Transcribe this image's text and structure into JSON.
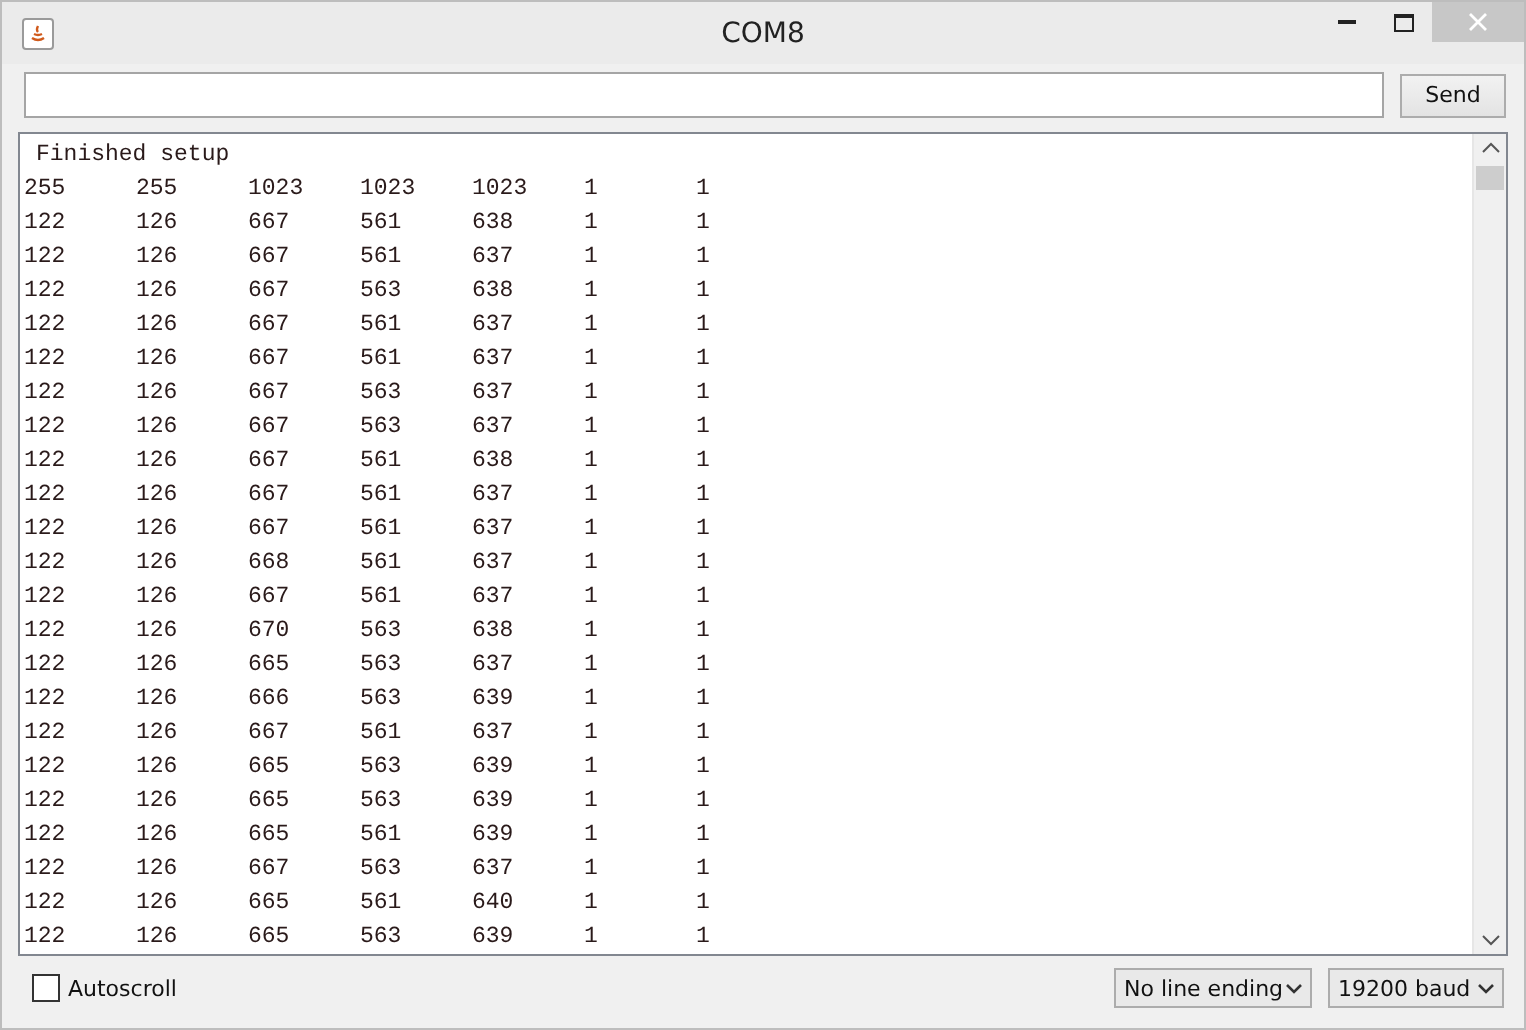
{
  "window": {
    "title": "COM8"
  },
  "send_button": "Send",
  "output": {
    "header": "Finished setup",
    "rows": [
      [
        "255",
        "255",
        "1023",
        "1023",
        "1023",
        "1",
        "1"
      ],
      [
        "122",
        "126",
        "667",
        "561",
        "638",
        "1",
        "1"
      ],
      [
        "122",
        "126",
        "667",
        "561",
        "637",
        "1",
        "1"
      ],
      [
        "122",
        "126",
        "667",
        "563",
        "638",
        "1",
        "1"
      ],
      [
        "122",
        "126",
        "667",
        "561",
        "637",
        "1",
        "1"
      ],
      [
        "122",
        "126",
        "667",
        "561",
        "637",
        "1",
        "1"
      ],
      [
        "122",
        "126",
        "667",
        "563",
        "637",
        "1",
        "1"
      ],
      [
        "122",
        "126",
        "667",
        "563",
        "637",
        "1",
        "1"
      ],
      [
        "122",
        "126",
        "667",
        "561",
        "638",
        "1",
        "1"
      ],
      [
        "122",
        "126",
        "667",
        "561",
        "637",
        "1",
        "1"
      ],
      [
        "122",
        "126",
        "667",
        "561",
        "637",
        "1",
        "1"
      ],
      [
        "122",
        "126",
        "668",
        "561",
        "637",
        "1",
        "1"
      ],
      [
        "122",
        "126",
        "667",
        "561",
        "637",
        "1",
        "1"
      ],
      [
        "122",
        "126",
        "670",
        "563",
        "638",
        "1",
        "1"
      ],
      [
        "122",
        "126",
        "665",
        "563",
        "637",
        "1",
        "1"
      ],
      [
        "122",
        "126",
        "666",
        "563",
        "639",
        "1",
        "1"
      ],
      [
        "122",
        "126",
        "667",
        "561",
        "637",
        "1",
        "1"
      ],
      [
        "122",
        "126",
        "665",
        "563",
        "639",
        "1",
        "1"
      ],
      [
        "122",
        "126",
        "665",
        "563",
        "639",
        "1",
        "1"
      ],
      [
        "122",
        "126",
        "665",
        "561",
        "639",
        "1",
        "1"
      ],
      [
        "122",
        "126",
        "667",
        "563",
        "637",
        "1",
        "1"
      ],
      [
        "122",
        "126",
        "665",
        "561",
        "640",
        "1",
        "1"
      ],
      [
        "122",
        "126",
        "665",
        "563",
        "639",
        "1",
        "1"
      ]
    ]
  },
  "autoscroll": {
    "label": "Autoscroll",
    "checked": false
  },
  "line_ending": {
    "value": "No line ending"
  },
  "baud": {
    "value": "19200 baud"
  }
}
